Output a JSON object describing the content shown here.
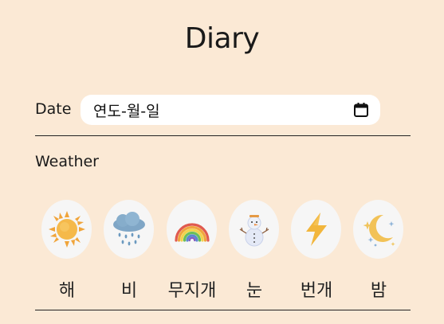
{
  "page": {
    "title": "Diary"
  },
  "date": {
    "label": "Date",
    "placeholder": "연도-월-일"
  },
  "weather": {
    "label": "Weather",
    "options": [
      {
        "label": "해",
        "icon": "sun-icon"
      },
      {
        "label": "비",
        "icon": "rain-cloud-icon"
      },
      {
        "label": "무지개",
        "icon": "rainbow-icon"
      },
      {
        "label": "눈",
        "icon": "snowman-icon"
      },
      {
        "label": "번개",
        "icon": "lightning-icon"
      },
      {
        "label": "밤",
        "icon": "moon-stars-icon"
      }
    ]
  },
  "colors": {
    "background": "#fbe9d5",
    "input_background": "#ffffff",
    "icon_bubble": "#f6f6f6",
    "text": "#1a1a1a"
  }
}
